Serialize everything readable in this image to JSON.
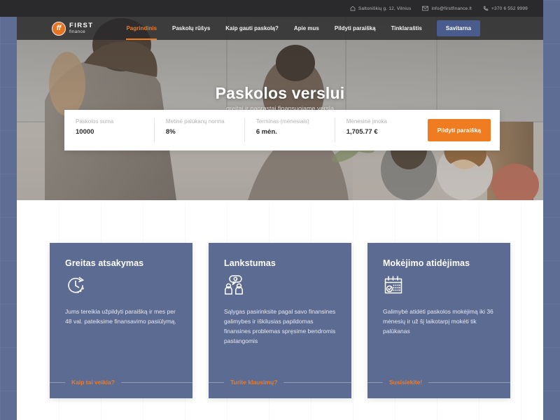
{
  "topbar": {
    "address": "Saltoniškių g. 12, Vilnius",
    "email": "info@firstfinance.lt",
    "phone": "+370 6 552 9999",
    "address_icon": "home-icon",
    "email_icon": "envelope-icon",
    "phone_icon": "phone-icon"
  },
  "brand": {
    "mark": "ff",
    "name_top": "FIRST",
    "name_bottom": "finance",
    "accent": "#e8731f"
  },
  "nav": {
    "items": [
      {
        "label": "Pagrindinis",
        "active": true
      },
      {
        "label": "Paskolų rūšys",
        "active": false
      },
      {
        "label": "Kaip gauti paskolą?",
        "active": false
      },
      {
        "label": "Apie mus",
        "active": false
      },
      {
        "label": "Pildyti paraišką",
        "active": false
      },
      {
        "label": "Tinklaraštis",
        "active": false
      }
    ],
    "cta": "Savitarna",
    "cta_color": "#4a5c8d",
    "active_color": "#f07c22"
  },
  "hero": {
    "title": "Paskolos verslui",
    "subtitle": "greitai ir paprastai finansuojame verslą"
  },
  "calculator": {
    "fields": [
      {
        "label": "Paskolos suma",
        "value": "10000"
      },
      {
        "label": "Metinė palūkanų norma",
        "value": "8%"
      },
      {
        "label": "Terminas (mėnesiais)",
        "value": "6 mėn."
      },
      {
        "label": "Mėnesinė įmoka",
        "value": "1,705.77 €"
      }
    ],
    "button": "Pildyti paraišką",
    "button_color": "#f07c22"
  },
  "cards": [
    {
      "title": "Greitas atsakymas",
      "icon": "clock-icon",
      "body": "Jums tereikia užpildyti paraišką ir mes per 48 val. pateiksime finansavimo pasiūlymą.",
      "link": "Kaip tai veikia?"
    },
    {
      "title": "Lankstumas",
      "icon": "people-chat-icon",
      "body": "Sąlygas pasirinksite pagal savo finansines galimybes ir iškilusias papildomas finansines problemas spręsime bendromis pastangomis",
      "link": "Turite klausimų?"
    },
    {
      "title": "Mokėjimo atidėjimas",
      "icon": "calendar-check-icon",
      "body": "Galimybė atidėti paskolos mokėjimą iki 36 mėnesių ir už šį laikotarpį mokėti tik palūkanas",
      "link": "Susisiekite!"
    }
  ],
  "theme": {
    "page_background": "#5e6d94",
    "card_background": "#5c6b92",
    "orange": "#f07c22",
    "dark": "#2a2a2c"
  }
}
